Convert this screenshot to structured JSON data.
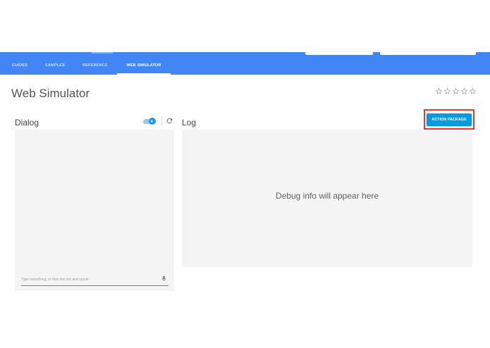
{
  "header": {
    "tabs": [
      {
        "label": "GUIDES",
        "active": false
      },
      {
        "label": "SAMPLES",
        "active": false
      },
      {
        "label": "REFERENCE",
        "active": false
      },
      {
        "label": "WEB SIMULATOR",
        "active": true
      }
    ],
    "accent_color": "#4285f4"
  },
  "page": {
    "title": "Web Simulator",
    "rating_icons": [
      "star-outline-icon",
      "star-outline-icon",
      "star-outline-icon",
      "star-outline-icon",
      "star-outline-icon"
    ]
  },
  "dialog": {
    "label": "Dialog",
    "audio_toggle_on": true,
    "toggle_icon": "speaker-icon",
    "refresh_icon": "refresh-icon",
    "input_placeholder": "Type something, or click the mic and speak",
    "mic_icon": "microphone-icon"
  },
  "log": {
    "label": "Log",
    "placeholder": "Debug info will appear here"
  },
  "action_package": {
    "label": "ACTION PACKAGE",
    "button_color": "#039be5",
    "highlight_color": "#e53935"
  }
}
